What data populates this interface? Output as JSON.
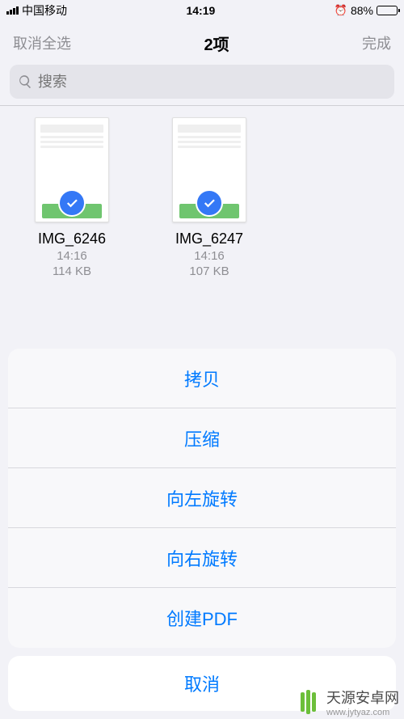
{
  "status": {
    "carrier": "中国移动",
    "time": "14:19",
    "battery_pct": "88%"
  },
  "nav": {
    "left": "取消全选",
    "title": "2项",
    "right": "完成"
  },
  "search": {
    "placeholder": "搜索"
  },
  "files": [
    {
      "name": "IMG_6246",
      "time": "14:16",
      "size": "114 KB"
    },
    {
      "name": "IMG_6247",
      "time": "14:16",
      "size": "107 KB"
    }
  ],
  "sheet": {
    "items": [
      "拷贝",
      "压缩",
      "向左旋转",
      "向右旋转",
      "创建PDF"
    ],
    "cancel": "取消"
  },
  "watermark": {
    "title": "天源安卓网",
    "url": "www.jytyaz.com"
  }
}
